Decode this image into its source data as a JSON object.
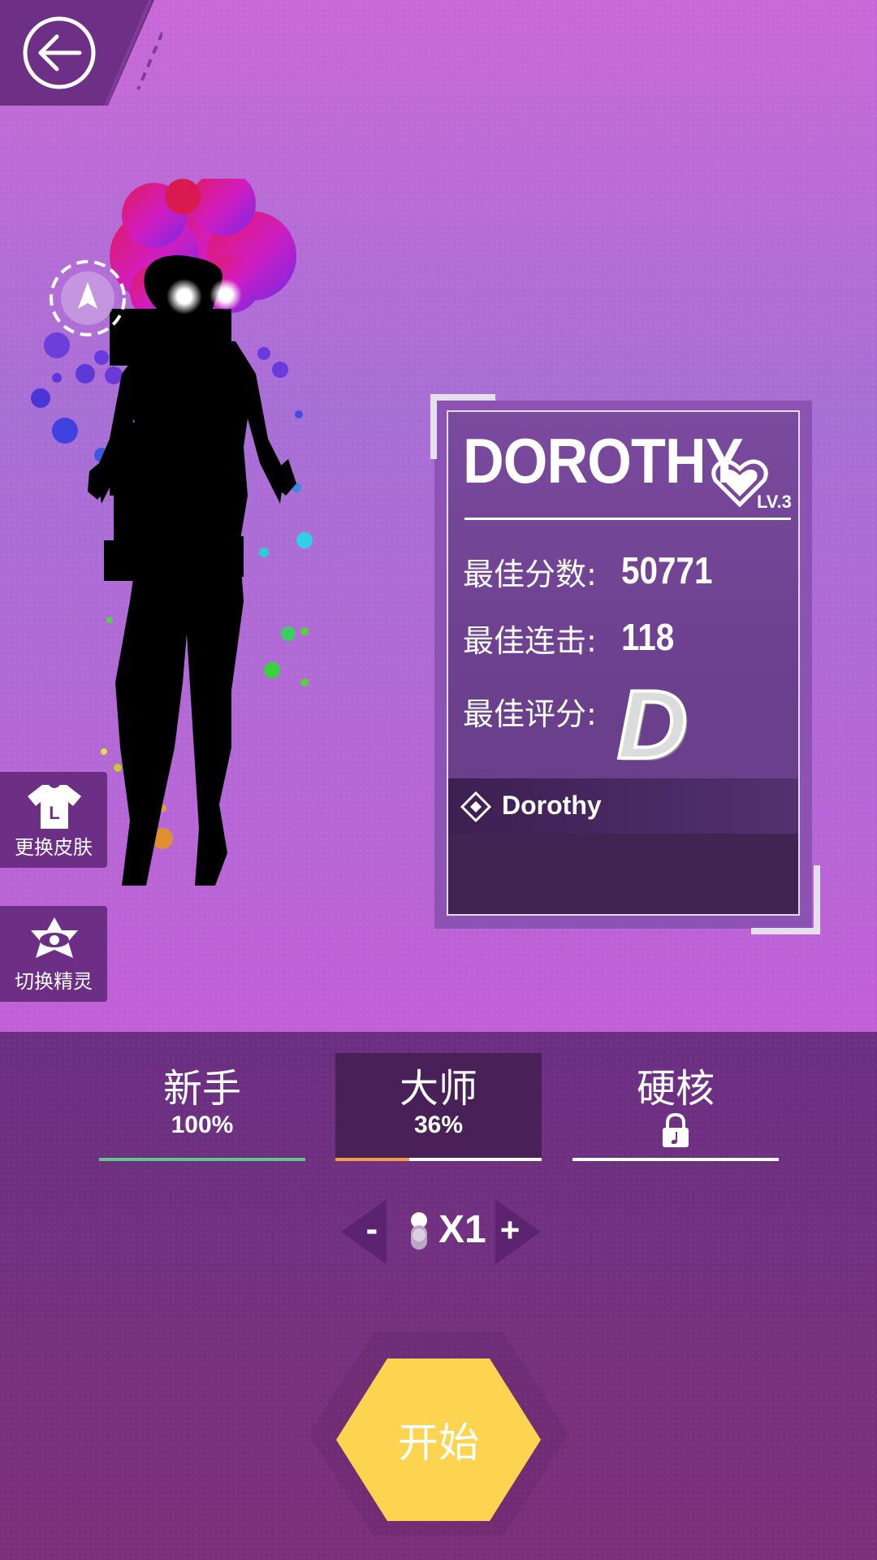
{
  "character": {
    "name": "DOROTHY",
    "level": "LV.3",
    "song": "Dorothy"
  },
  "stats": {
    "best_score_label": "最佳分数:",
    "best_score": "50771",
    "best_combo_label": "最佳连击:",
    "best_combo": "118",
    "best_grade_label": "最佳评分:",
    "best_grade": "D"
  },
  "side_buttons": {
    "change_skin": "更换皮肤",
    "switch_spirit": "切换精灵"
  },
  "difficulty": {
    "tabs": [
      {
        "name": "新手",
        "progress": "100%",
        "progress_value": 1.0,
        "color": "#5ec88a",
        "locked": false,
        "active": false
      },
      {
        "name": "大师",
        "progress": "36%",
        "progress_value": 0.36,
        "color": "#f0a040",
        "locked": false,
        "active": true
      },
      {
        "name": "硬核",
        "progress": "",
        "progress_value": 0,
        "color": "#ffffff",
        "locked": true,
        "active": false
      }
    ]
  },
  "speed": {
    "minus": "-",
    "value": "X1",
    "plus": "+"
  },
  "start_button": "开始",
  "icons": {
    "back": "back-arrow-icon",
    "skin": "shirt-icon",
    "spirit": "eye-star-icon",
    "level": "heart-icon",
    "song": "diamond-icon",
    "lock": "lock-icon"
  },
  "colors": {
    "accent_yellow": "#fcd450",
    "panel_dark": "#6d2f85",
    "master_progress": "#f0a040",
    "novice_progress": "#5ec88a"
  }
}
